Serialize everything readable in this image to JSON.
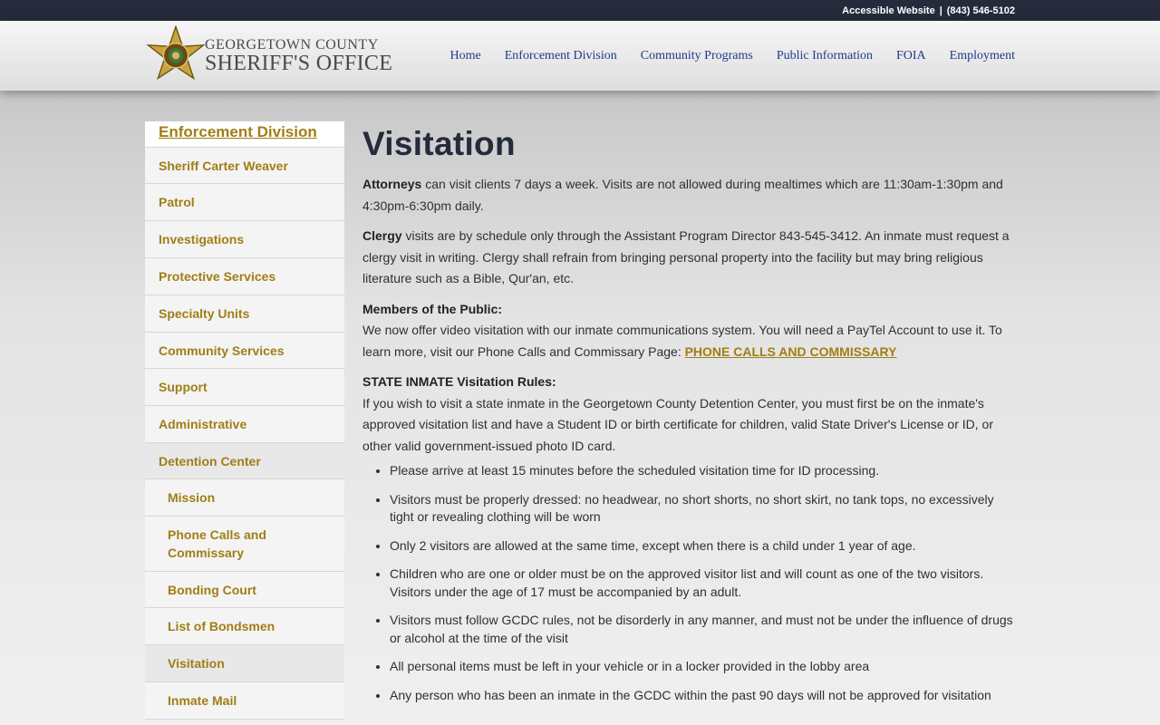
{
  "topbar": {
    "accessible_label": "Accessible Website",
    "separator": "|",
    "phone": "(843) 546-5102"
  },
  "logo": {
    "line1": "GEORGETOWN COUNTY",
    "line2": "SHERIFF'S OFFICE"
  },
  "nav": {
    "items": [
      "Home",
      "Enforcement Division",
      "Community Programs",
      "Public Information",
      "FOIA",
      "Employment"
    ]
  },
  "sidebar": {
    "heading": "Enforcement Division",
    "items": [
      {
        "label": "Sheriff Carter Weaver"
      },
      {
        "label": "Patrol"
      },
      {
        "label": "Investigations"
      },
      {
        "label": "Protective Services"
      },
      {
        "label": "Specialty Units"
      },
      {
        "label": "Community Services"
      },
      {
        "label": "Support"
      },
      {
        "label": "Administrative"
      },
      {
        "label": "Detention Center"
      },
      {
        "label": "Mission"
      },
      {
        "label": "Phone Calls and Commissary"
      },
      {
        "label": "Bonding Court"
      },
      {
        "label": "List of Bondsmen"
      },
      {
        "label": "Visitation"
      },
      {
        "label": "Inmate Mail"
      }
    ]
  },
  "main": {
    "title": "Visitation",
    "attorneys_bold": "Attorneys",
    "attorneys_text": " can visit clients 7 days a week. Visits are not allowed during mealtimes which are 11:30am-1:30pm and 4:30pm-6:30pm daily.",
    "clergy_bold": "Clergy",
    "clergy_text": " visits are by schedule only through the Assistant Program Director 843-545-3412. An inmate must request a clergy visit in writing. Clergy shall refrain from bringing personal property into the facility but may bring religious literature such as a Bible, Qur'an, etc.",
    "public_heading": "Members of the Public:",
    "public_text": "We now offer video visitation with our inmate communications system. You will need a PayTel Account to use it. To learn more, visit our Phone Calls and Commissary Page: ",
    "public_link": "PHONE CALLS AND COMMISSARY",
    "state_heading": "STATE INMATE Visitation Rules:",
    "state_text": "If you wish to visit a state inmate in the Georgetown County Detention Center, you must first be on the inmate's approved visitation list and have a Student ID or birth certificate for children, valid State Driver's License or ID, or other valid government-issued photo ID card.",
    "rules": [
      "Please arrive at least 15 minutes before the scheduled visitation time for ID processing.",
      "Visitors must be properly dressed: no headwear, no short shorts, no short skirt, no tank tops, no excessively tight or revealing clothing will be worn",
      "Only 2 visitors are allowed at the same time, except when there is a child under 1 year of age.",
      "Children who are one or older must be on the approved visitor list and will count as one of the two visitors. Visitors under the age of 17 must be accompanied by an adult.",
      "Visitors must follow GCDC rules, not be disorderly in any manner, and must not be under the influence of drugs or alcohol at the time of the visit",
      "All personal items must be left in your vehicle or in a locker provided in the lobby area",
      "Any person who has been an inmate in the GCDC within the past 90 days will not be approved for visitation"
    ]
  }
}
